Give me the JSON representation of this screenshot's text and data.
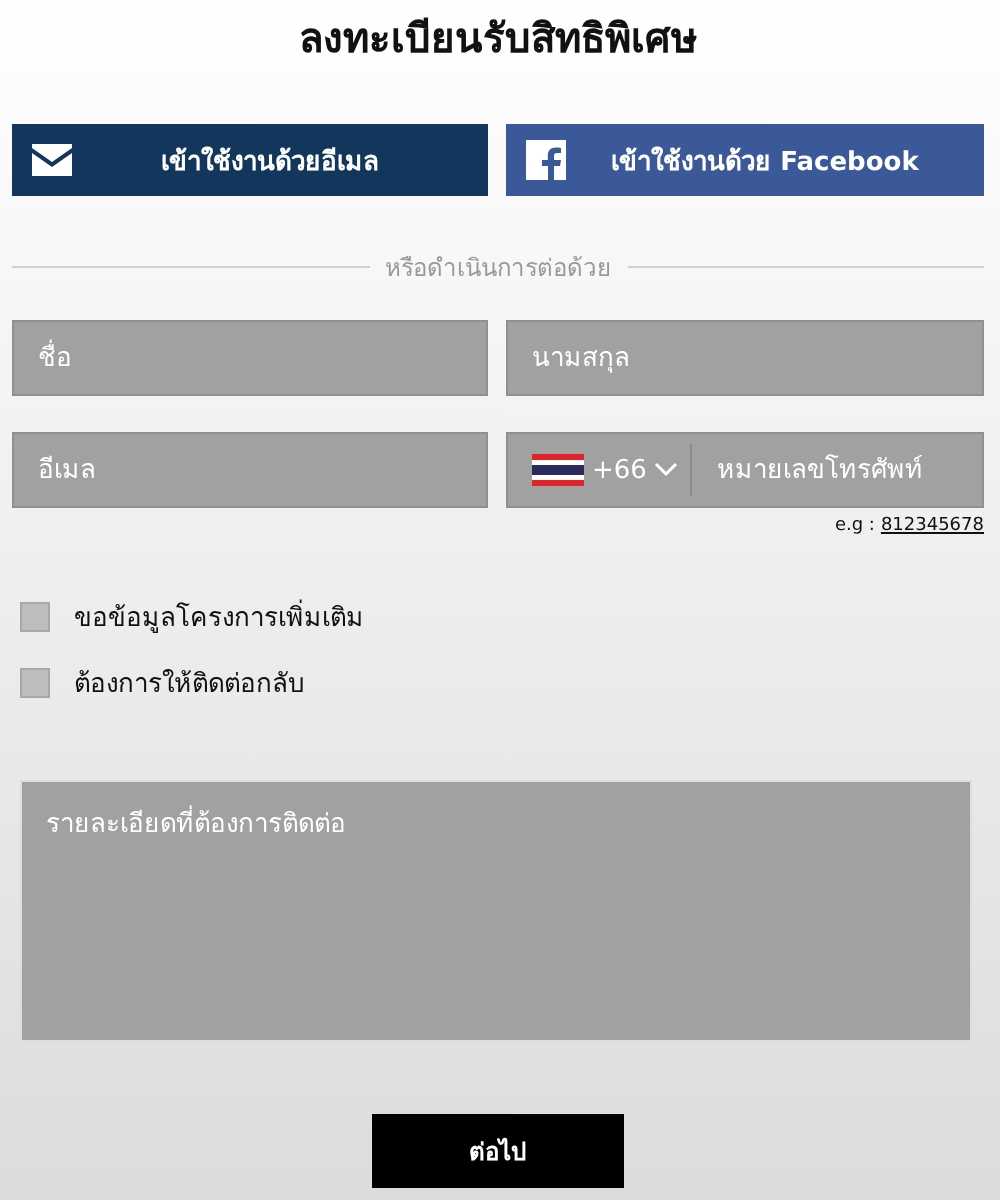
{
  "title": "ลงทะเบียนรับสิทธิพิเศษ",
  "social_buttons": [
    {
      "kind": "email",
      "label": "เข้าใช้งานด้วยอีเมล"
    },
    {
      "kind": "facebook",
      "label": "เข้าใช้งานด้วย Facebook"
    }
  ],
  "divider_text": "หรือดำเนินการต่อด้วย",
  "fields": {
    "first_name": {
      "placeholder": "ชื่อ"
    },
    "last_name": {
      "placeholder": "นามสกุล"
    },
    "email": {
      "placeholder": "อีเมล"
    },
    "phone": {
      "country_code": "+66",
      "placeholder": "หมายเลขโทรศัพท์",
      "example_label": "e.g :",
      "example_value": "812345678"
    }
  },
  "checkboxes": [
    {
      "label": "ขอข้อมูลโครงการเพิ่มเติม",
      "checked": false
    },
    {
      "label": "ต้องการให้ติดต่อกลับ",
      "checked": false
    }
  ],
  "details": {
    "placeholder": "รายละเอียดที่ต้องการติดต่อ"
  },
  "submit_button": "ต่อไป"
}
